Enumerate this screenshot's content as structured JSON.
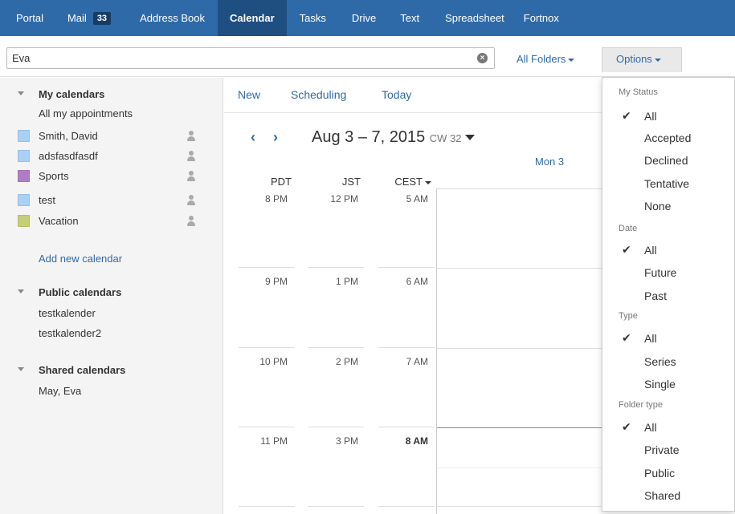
{
  "topnav": {
    "items": [
      {
        "label": "Portal"
      },
      {
        "label": "Mail",
        "badge": "33"
      },
      {
        "label": "Address Book"
      },
      {
        "label": "Calendar"
      },
      {
        "label": "Tasks"
      },
      {
        "label": "Drive"
      },
      {
        "label": "Text"
      },
      {
        "label": "Spreadsheet"
      },
      {
        "label": "Fortnox"
      }
    ],
    "active": "Calendar"
  },
  "search": {
    "value": "Eva",
    "clear_icon": "clear-circle-icon"
  },
  "folders": {
    "label": "All Folders"
  },
  "options": {
    "label": "Options"
  },
  "sidebar": {
    "my_calendars": {
      "title": "My calendars",
      "all_appointments": "All my appointments",
      "items": [
        {
          "name": "Smith, David",
          "color": "#a9d0f5"
        },
        {
          "name": "adsfasdfasdf",
          "color": "#a9d0f5"
        },
        {
          "name": "Sports",
          "color": "#b07cc6"
        },
        {
          "name": "test",
          "color": "#a9d0f5"
        },
        {
          "name": "Vacation",
          "color": "#c5ce74"
        }
      ],
      "add_label": "Add new calendar"
    },
    "public_calendars": {
      "title": "Public calendars",
      "items": [
        "testkalender",
        "testkalender2"
      ]
    },
    "shared_calendars": {
      "title": "Shared calendars",
      "items": [
        "May, Eva"
      ]
    }
  },
  "toolbar": {
    "new": "New",
    "scheduling": "Scheduling",
    "today": "Today"
  },
  "calendar": {
    "prev_icon": "chevron-left-icon",
    "next_icon": "chevron-right-icon",
    "range": "Aug 3 – 7, 2015",
    "cw": "CW 32",
    "day_header": "Mon 3",
    "timezones": [
      "PDT",
      "JST",
      "CEST"
    ],
    "rows": [
      [
        "8 PM",
        "12 PM",
        "5 AM"
      ],
      [
        "9 PM",
        "1 PM",
        "6 AM"
      ],
      [
        "10 PM",
        "2 PM",
        "7 AM"
      ],
      [
        "11 PM",
        "3 PM",
        "8 AM"
      ]
    ]
  },
  "dropdown": {
    "groups": [
      {
        "title": "My Status",
        "items": [
          {
            "label": "All",
            "checked": true
          },
          {
            "label": "Accepted"
          },
          {
            "label": "Declined"
          },
          {
            "label": "Tentative"
          },
          {
            "label": "None"
          }
        ]
      },
      {
        "title": "Date",
        "items": [
          {
            "label": "All",
            "checked": true
          },
          {
            "label": "Future"
          },
          {
            "label": "Past"
          }
        ]
      },
      {
        "title": "Type",
        "items": [
          {
            "label": "All",
            "checked": true
          },
          {
            "label": "Series"
          },
          {
            "label": "Single"
          }
        ]
      },
      {
        "title": "Folder type",
        "items": [
          {
            "label": "All",
            "checked": true
          },
          {
            "label": "Private"
          },
          {
            "label": "Public"
          },
          {
            "label": "Shared"
          }
        ]
      }
    ],
    "check_icon": "checkmark-icon"
  }
}
